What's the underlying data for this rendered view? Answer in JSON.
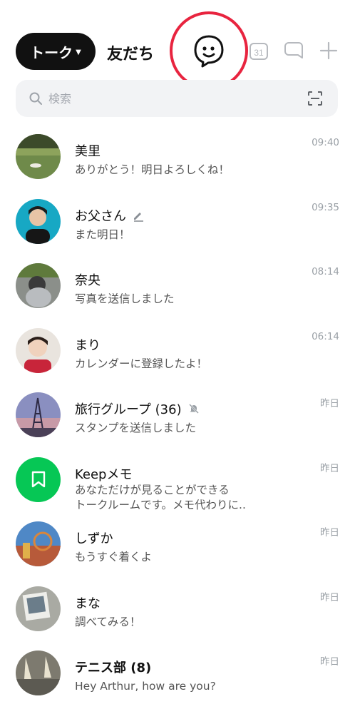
{
  "header": {
    "talk_tab": "トーク",
    "friends_tab": "友だち",
    "calendar_day": "31"
  },
  "search": {
    "placeholder": "検索"
  },
  "chats": [
    {
      "name": "美里",
      "message": "ありがとう！明日よろしくね！",
      "time": "09:40"
    },
    {
      "name": "お父さん",
      "message": "また明日！",
      "time": "09:35"
    },
    {
      "name": "奈央",
      "message": "写真を送信しました",
      "time": "08:14"
    },
    {
      "name": "まり",
      "message": "カレンダーに登録したよ！",
      "time": "06:14"
    },
    {
      "name": "旅行グループ (36)",
      "message": "スタンプを送信しました",
      "time": "昨日"
    },
    {
      "name": "Keepメモ",
      "message_line1": "あなただけが見ることができる",
      "message_line2": "トークルームです。メモ代わりに..",
      "time": "昨日"
    },
    {
      "name": "しずか",
      "message": "もうすぐ着くよ",
      "time": "昨日"
    },
    {
      "name": "まな",
      "message": "調べてみる！",
      "time": "昨日"
    },
    {
      "name": "テニス部 (8)",
      "message": "Hey Arthur, how are you?",
      "time": "昨日"
    }
  ],
  "colors": {
    "accent_ring": "#e8243f",
    "keep_green": "#06c755",
    "pill_bg": "#111111"
  }
}
